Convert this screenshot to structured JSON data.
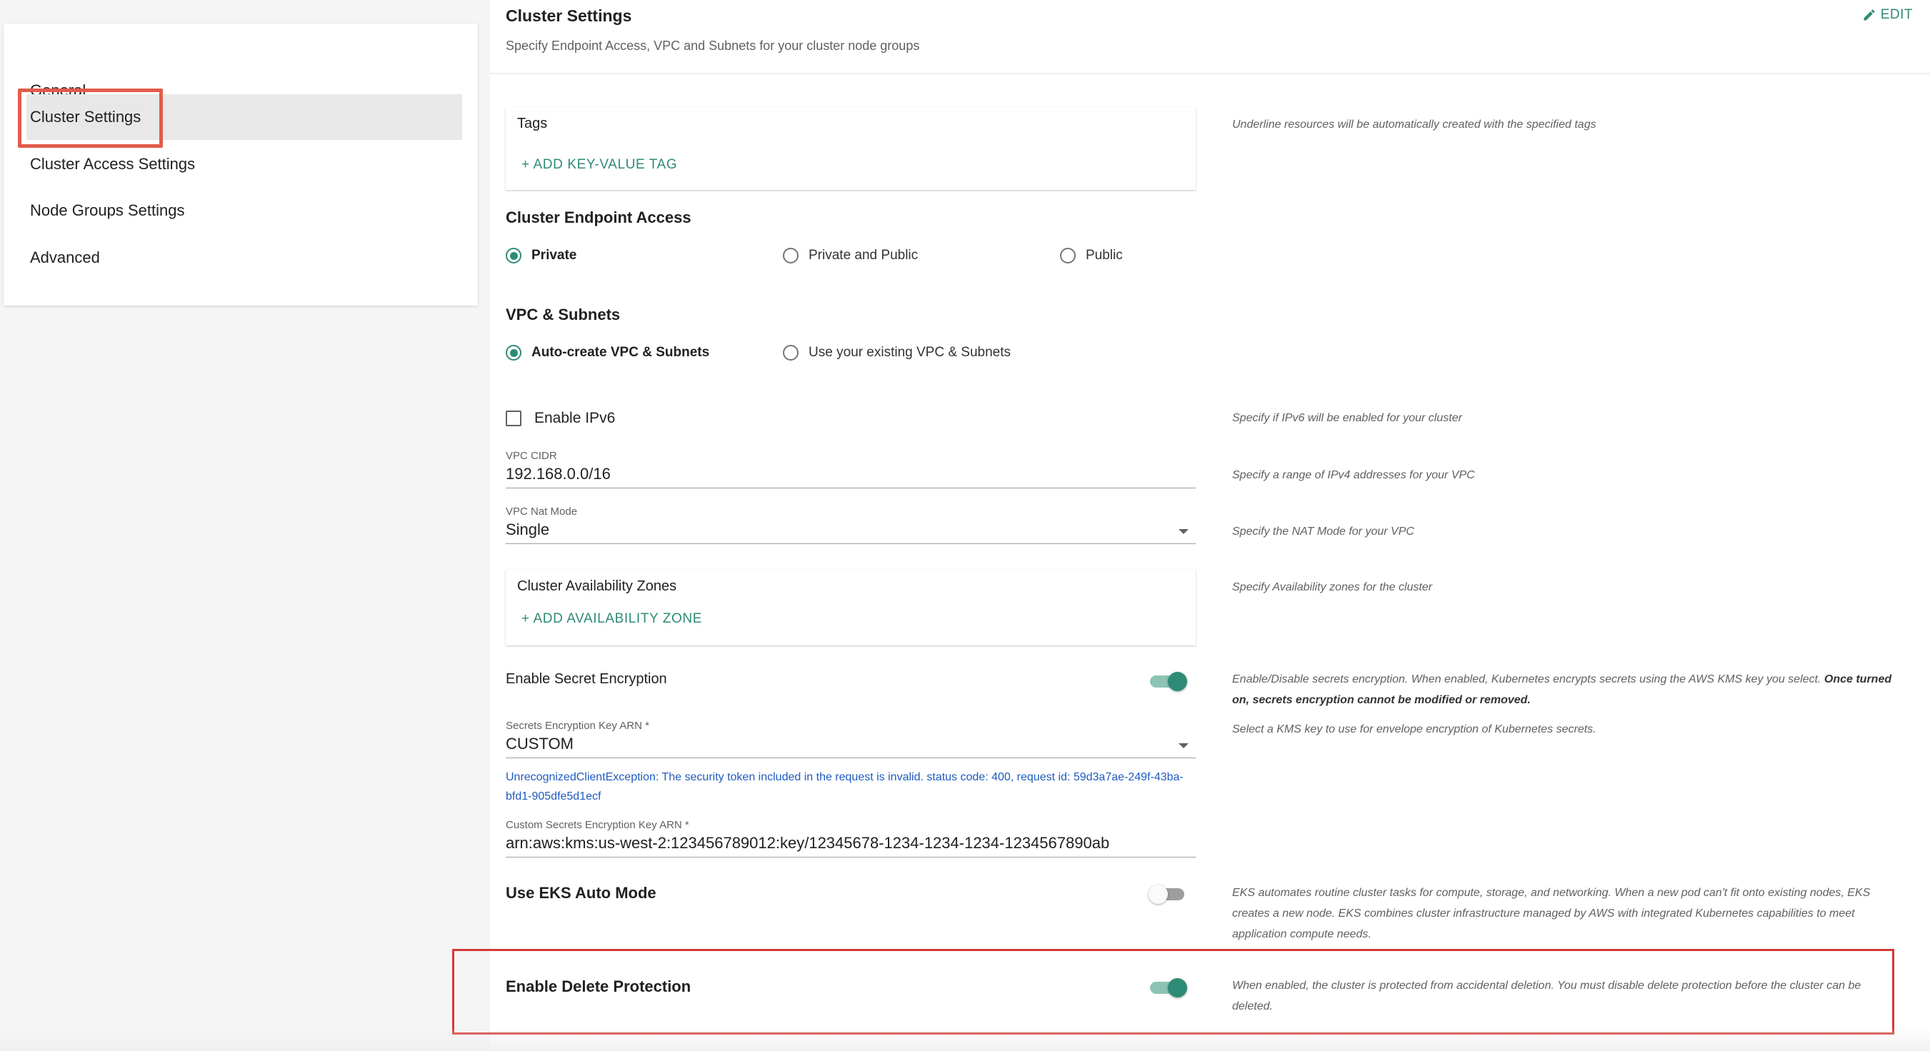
{
  "sidebar": {
    "items": [
      {
        "label": "General"
      },
      {
        "label": "Cluster Settings",
        "active": true
      },
      {
        "label": "Cluster Access Settings"
      },
      {
        "label": "Node Groups Settings"
      },
      {
        "label": "Advanced"
      }
    ]
  },
  "header": {
    "title": "Cluster Settings",
    "subtitle": "Specify Endpoint Access, VPC and Subnets for your cluster node groups",
    "edit_label": "EDIT"
  },
  "tags": {
    "title": "Tags",
    "add_label": "+ ADD KEY-VALUE TAG",
    "help": "Underline resources will be automatically created with the specified tags"
  },
  "endpoint": {
    "title": "Cluster Endpoint Access",
    "options": [
      "Private",
      "Private and Public",
      "Public"
    ],
    "selected": "Private"
  },
  "vpc": {
    "title": "VPC & Subnets",
    "options": [
      "Auto-create VPC & Subnets",
      "Use your existing VPC & Subnets"
    ],
    "selected": "Auto-create VPC & Subnets"
  },
  "ipv6": {
    "label": "Enable IPv6",
    "checked": false,
    "help": "Specify if IPv6 will be enabled for your cluster"
  },
  "vpc_cidr": {
    "label": "VPC CIDR",
    "value": "192.168.0.0/16",
    "help": "Specify a range of IPv4 addresses for your VPC"
  },
  "nat_mode": {
    "label": "VPC Nat Mode",
    "value": "Single",
    "help": "Specify the NAT Mode for your VPC"
  },
  "az": {
    "title": "Cluster Availability Zones",
    "add_label": "+ ADD  AVAILABILITY ZONE",
    "help": "Specify Availability zones for the cluster"
  },
  "secret_encryption": {
    "label": "Enable Secret Encryption",
    "on": true,
    "help_part1": "Enable/Disable secrets encryption. When enabled, Kubernetes encrypts secrets using the AWS KMS key you select.",
    "help_bold": "Once turned on, secrets encryption cannot be modified or removed."
  },
  "kms_key": {
    "label": "Secrets Encryption Key ARN *",
    "value": "CUSTOM",
    "help": "Select a KMS key to use for envelope encryption of Kubernetes secrets.",
    "error": "UnrecognizedClientException: The security token included in the request is invalid. status code: 400, request id: 59d3a7ae-249f-43ba-bfd1-905dfe5d1ecf"
  },
  "custom_kms": {
    "label": "Custom Secrets Encryption Key ARN *",
    "value": "arn:aws:kms:us-west-2:123456789012:key/12345678-1234-1234-1234-1234567890ab"
  },
  "eks_auto": {
    "label": "Use EKS Auto Mode",
    "on": false,
    "help": "EKS automates routine cluster tasks for compute, storage, and networking. When a new pod can't fit onto existing nodes, EKS creates a new node. EKS combines cluster infrastructure managed by AWS with integrated Kubernetes capabilities to meet application compute needs."
  },
  "delete_protection": {
    "label": "Enable Delete Protection",
    "on": true,
    "help": "When enabled, the cluster is protected from accidental deletion. You must disable delete protection before the cluster can be deleted."
  },
  "colors": {
    "accent": "#2e8b75",
    "highlight": "#e25b4b",
    "error_link": "#1e5bbf"
  }
}
